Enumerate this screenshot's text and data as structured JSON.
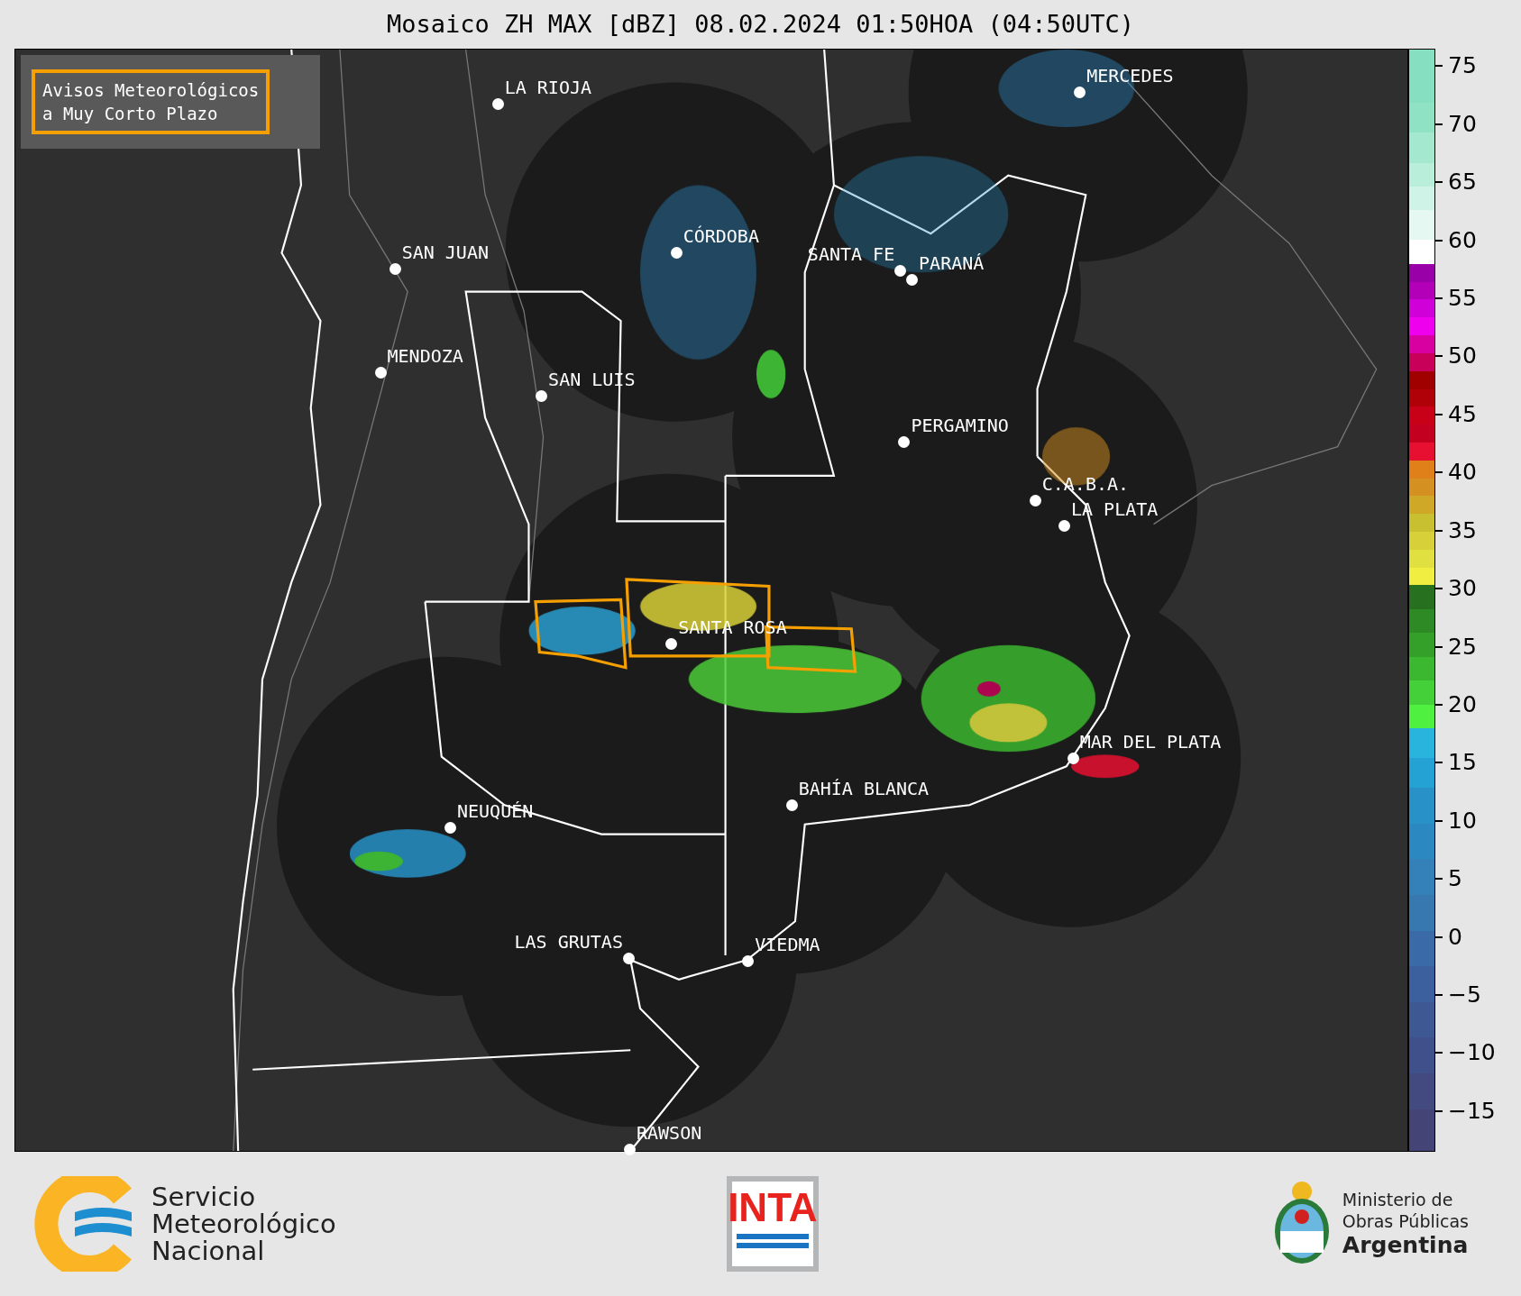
{
  "title": "Mosaico ZH MAX [dBZ] 08.02.2024 01:50HOA (04:50UTC)",
  "legend_box": {
    "lines": [
      "Avisos Meteorológicos",
      "a Muy Corto Plazo"
    ]
  },
  "cities": [
    {
      "name": "LA RIOJA"
    },
    {
      "name": "MERCEDES"
    },
    {
      "name": "SAN JUAN"
    },
    {
      "name": "CÓRDOBA"
    },
    {
      "name": "SANTA FE"
    },
    {
      "name": "PARANÁ"
    },
    {
      "name": "MENDOZA"
    },
    {
      "name": "SAN LUIS"
    },
    {
      "name": "PERGAMINO"
    },
    {
      "name": "C.A.B.A."
    },
    {
      "name": "LA PLATA"
    },
    {
      "name": "SANTA ROSA"
    },
    {
      "name": "MAR DEL PLATA"
    },
    {
      "name": "BAHÍA BLANCA"
    },
    {
      "name": "NEUQUÉN"
    },
    {
      "name": "LAS GRUTAS"
    },
    {
      "name": "VIEDMA"
    },
    {
      "name": "RAWSON"
    }
  ],
  "colorbar": {
    "ticks": [
      "75",
      "70",
      "65",
      "60",
      "55",
      "50",
      "45",
      "40",
      "35",
      "30",
      "25",
      "20",
      "15",
      "10",
      "5",
      "0",
      "−5",
      "−10",
      "−15"
    ]
  },
  "footer": {
    "smn": [
      "Servicio",
      "Meteorológico",
      "Nacional"
    ],
    "inta": "INTA",
    "ministry": [
      "Ministerio de",
      "Obras Públicas",
      "Argentina"
    ]
  }
}
